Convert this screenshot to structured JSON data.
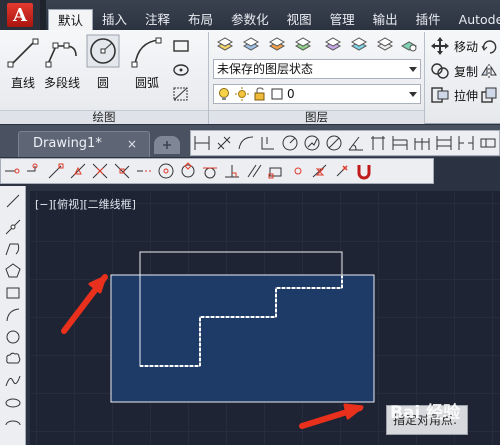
{
  "app": {
    "logo_letter": "A"
  },
  "menu_tabs": [
    "默认",
    "插入",
    "注释",
    "布局",
    "参数化",
    "视图",
    "管理",
    "输出",
    "插件",
    "Autode"
  ],
  "draw_panel": {
    "title": "绘图",
    "tools": [
      {
        "label": "直线",
        "icon": "line-icon"
      },
      {
        "label": "多段线",
        "icon": "polyline-icon"
      },
      {
        "label": "圆",
        "icon": "circle-icon"
      },
      {
        "label": "圆弧",
        "icon": "arc-icon"
      }
    ]
  },
  "layers_panel": {
    "title": "图层",
    "layer_state_value": "未保存的图层状态",
    "current_layer_value": "0"
  },
  "modify_panel": {
    "tools": [
      {
        "label": "移动",
        "icon": "move-icon"
      },
      {
        "label": "复制",
        "icon": "copy-icon"
      },
      {
        "label": "拉伸",
        "icon": "stretch-icon"
      }
    ]
  },
  "document_tab": {
    "name": "Drawing1*",
    "close": "×"
  },
  "viewport": {
    "label": "[−][俯视][二维线框]"
  },
  "tooltip": {
    "text": "指定对角点:"
  },
  "watermark": {
    "text": "Bai 经验"
  },
  "colors": {
    "canvas": "#1e2433",
    "selection_fill": "#1e3a66",
    "arrow": "#e8301c"
  }
}
